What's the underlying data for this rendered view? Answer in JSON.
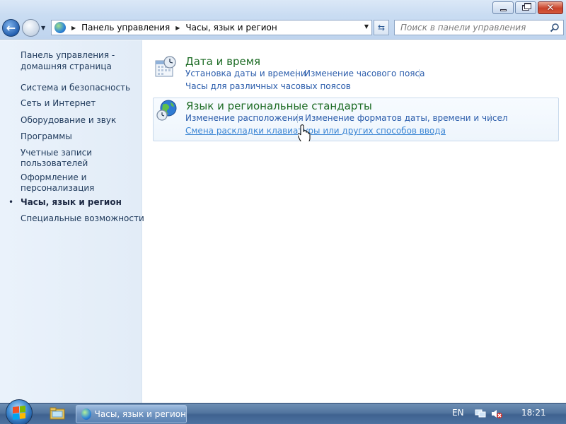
{
  "window": {
    "minimize_icon": "minimize-icon",
    "maximize_icon": "restore-icon",
    "close_icon": "close-icon"
  },
  "address_bar": {
    "crumbs": [
      "Панель управления",
      "Часы, язык и регион"
    ]
  },
  "search": {
    "placeholder": "Поиск в панели управления"
  },
  "sidebar": {
    "items": [
      {
        "label": "Панель управления -"
      },
      {
        "label": "домашняя страница"
      },
      {
        "label": "Система и безопасность"
      },
      {
        "label": "Сеть и Интернет"
      },
      {
        "label": "Оборудование и звук"
      },
      {
        "label": "Программы"
      },
      {
        "label": "Учетные записи"
      },
      {
        "label": "пользователей"
      },
      {
        "label": "Оформление и"
      },
      {
        "label": "персонализация"
      },
      {
        "label": "Часы, язык и регион"
      },
      {
        "label": "Специальные возможности"
      }
    ],
    "active_bullet": "•"
  },
  "categories": [
    {
      "title": "Дата и время",
      "tasks": [
        "Установка даты и времени",
        "Изменение часового пояса",
        "Часы для различных часовых поясов"
      ]
    },
    {
      "title": "Язык и региональные стандарты",
      "tasks": [
        "Изменение расположения",
        "Изменение форматов даты, времени и чисел",
        "Смена раскладки клавиатуры или других способов ввода"
      ]
    }
  ],
  "taskbar": {
    "active_window": "Часы, язык и регион",
    "language": "EN",
    "clock": "18:21"
  },
  "colors": {
    "category_title": "#1c6b24",
    "link": "#2a5cab",
    "link_hover": "#3b86d4"
  }
}
